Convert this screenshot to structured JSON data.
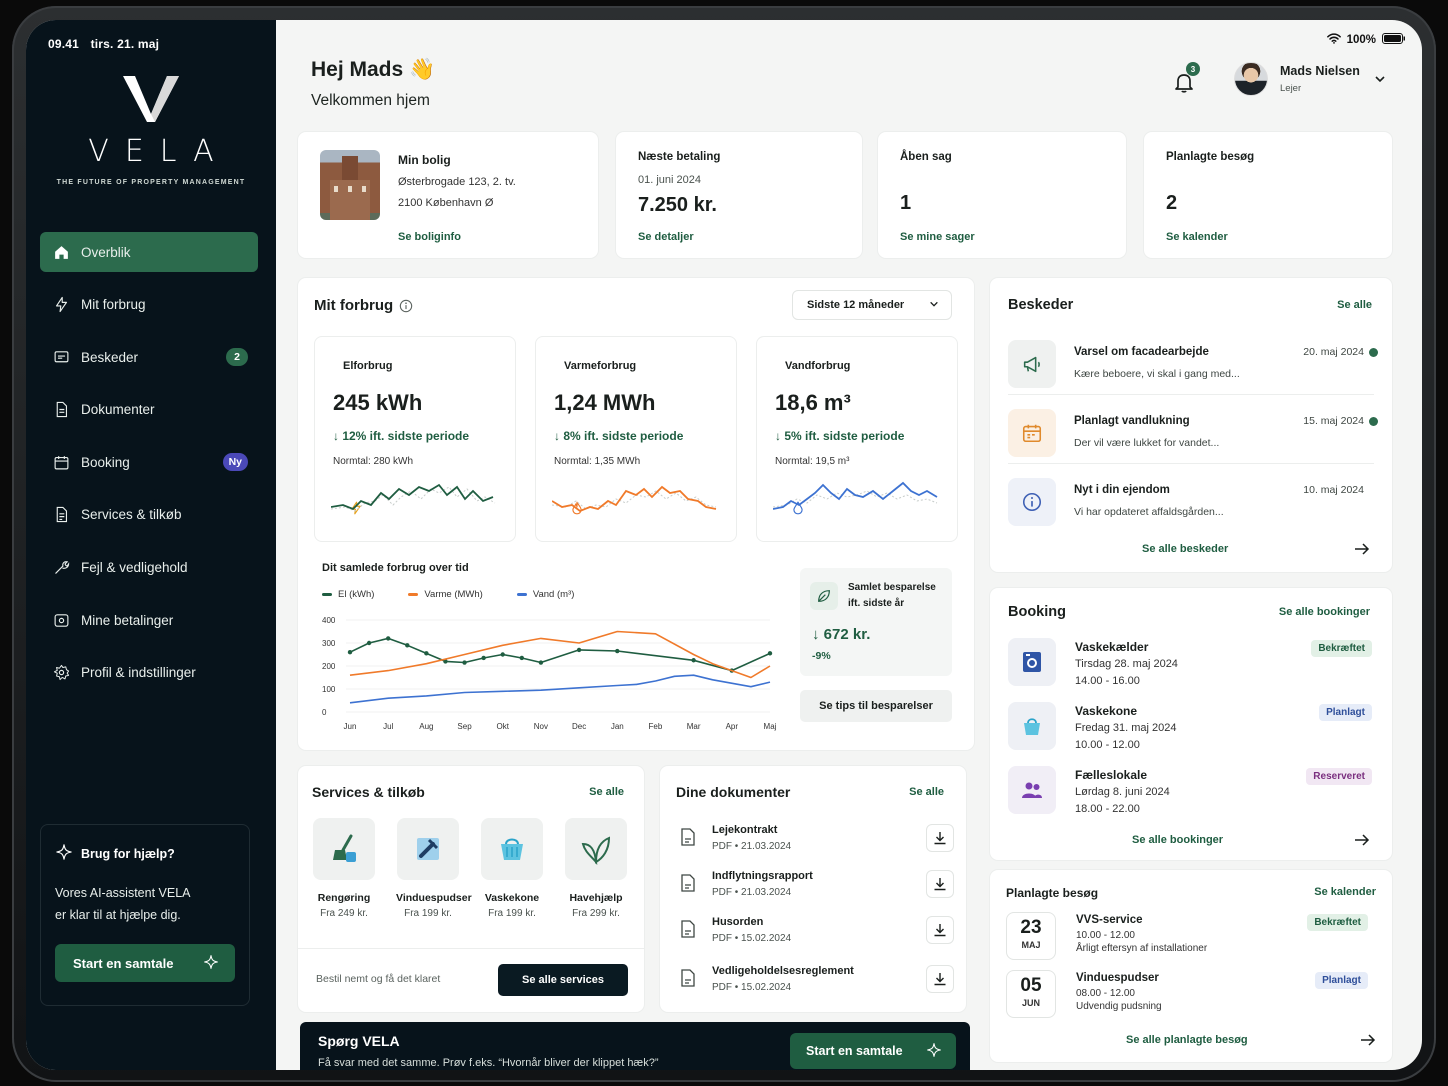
{
  "status": {
    "time": "09.41",
    "date": "tirs. 21. maj",
    "battery": "100%"
  },
  "brand": {
    "name": "VELA",
    "tagline": "THE FUTURE OF PROPERTY MANAGEMENT"
  },
  "sidebar": {
    "items": [
      {
        "label": "Overblik",
        "icon": "home-icon",
        "active": true
      },
      {
        "label": "Mit forbrug",
        "icon": "bolt-icon"
      },
      {
        "label": "Beskeder",
        "icon": "message-icon",
        "badge": "2"
      },
      {
        "label": "Dokumenter",
        "icon": "document-icon"
      },
      {
        "label": "Booking",
        "icon": "calendar-icon",
        "badge": "Ny"
      },
      {
        "label": "Services & tilkøb",
        "icon": "services-icon"
      },
      {
        "label": "Fejl & vedligehold",
        "icon": "wrench-icon"
      },
      {
        "label": "Mine betalinger",
        "icon": "payment-icon"
      },
      {
        "label": "Profil & indstillinger",
        "icon": "gear-icon"
      }
    ],
    "help": {
      "title": "Brug for hjælp?",
      "text_line1": "Vores AI-assistent VELA",
      "text_line2": "er klar til at hjælpe dig.",
      "button": "Start en samtale"
    }
  },
  "header": {
    "greeting": "Hej Mads 👋",
    "subtitle": "Velkommen hjem",
    "notifications": "3",
    "user_name": "Mads Nielsen",
    "user_role": "Lejer"
  },
  "summary": {
    "home": {
      "title": "Min bolig",
      "line1": "Østerbrogade 123, 2. tv.",
      "line2": "2100 København Ø",
      "link": "Se boliginfo"
    },
    "payment": {
      "title": "Næste betaling",
      "date": "01. juni 2024",
      "amount": "7.250 kr.",
      "link": "Se detaljer"
    },
    "case": {
      "title": "Åben sag",
      "count": "1",
      "link": "Se mine sager"
    },
    "visits": {
      "title": "Planlagte besøg",
      "count": "2",
      "link": "Se kalender"
    }
  },
  "consumption": {
    "title": "Mit forbrug",
    "period": "Sidste 12 måneder",
    "el": {
      "title": "Elforbrug",
      "value": "245 kWh",
      "delta": "↓ 12% ift. sidste periode",
      "normal": "Normtal: 280 kWh",
      "color": "#1f5d41"
    },
    "heat": {
      "title": "Varmeforbrug",
      "value": "1,24 MWh",
      "delta": "↓ 8% ift. sidste periode",
      "normal": "Normtal: 1,35 MWh",
      "color": "#f07a2a"
    },
    "water": {
      "title": "Vandforbrug",
      "value": "18,6 m³",
      "delta": "↓ 5% ift. sidste periode",
      "normal": "Normtal: 19,5 m³",
      "color": "#3d72d1"
    },
    "overtime_title": "Dit samlede forbrug over tid",
    "savings": {
      "title_line1": "Samlet besparelse",
      "title_line2": "ift. sidste år",
      "amount": "↓ 672 kr.",
      "pct": "-9%",
      "button": "Se tips til besparelser"
    }
  },
  "chart_data": {
    "type": "line",
    "title": "Dit samlede forbrug over tid",
    "categories": [
      "Jun",
      "Jul",
      "Aug",
      "Sep",
      "Okt",
      "Nov",
      "Dec",
      "Jan",
      "Feb",
      "Mar",
      "Apr",
      "Maj"
    ],
    "ylim": [
      0,
      400
    ],
    "yticks": [
      0,
      100,
      200,
      300,
      400
    ],
    "series": [
      {
        "name": "El (kWh)",
        "color": "#1f5d41",
        "values": [
          260,
          300,
          320,
          290,
          255,
          220,
          215,
          235,
          250,
          235,
          215,
          270,
          265,
          225,
          180,
          255
        ],
        "x": [
          0,
          0.5,
          1,
          1.5,
          2,
          2.5,
          3,
          3.5,
          4,
          4.5,
          5,
          6,
          7,
          9,
          10,
          11
        ]
      },
      {
        "name": "Varme (MWh)",
        "color": "#f07a2a",
        "values": [
          160,
          180,
          210,
          250,
          290,
          320,
          300,
          350,
          340,
          250,
          210,
          150,
          200
        ],
        "x": [
          0,
          1,
          2,
          3,
          4,
          5,
          6,
          7,
          8,
          9,
          9.5,
          10.5,
          11
        ]
      },
      {
        "name": "Vand (m³)",
        "color": "#3d72d1",
        "values": [
          40,
          60,
          70,
          85,
          90,
          95,
          105,
          115,
          120,
          135,
          155,
          160,
          140,
          110,
          130
        ],
        "x": [
          0,
          1,
          2,
          3,
          4,
          5,
          6,
          7,
          7.5,
          8,
          8.5,
          9,
          9.5,
          10.5,
          11
        ]
      }
    ]
  },
  "services": {
    "title": "Services & tilkøb",
    "link": "Se alle",
    "items": [
      {
        "name": "Rengøring",
        "price": "Fra 249 kr.",
        "icon": "broom-icon"
      },
      {
        "name": "Vinduespudser",
        "price": "Fra 199 kr.",
        "icon": "squeegee-icon"
      },
      {
        "name": "Vaskekone",
        "price": "Fra 199 kr.",
        "icon": "basket-icon"
      },
      {
        "name": "Havehjælp",
        "price": "Fra 299 kr.",
        "icon": "leaf-icon"
      }
    ],
    "footer_text": "Bestil nemt og få det klaret",
    "footer_button": "Se alle services"
  },
  "documents": {
    "title": "Dine dokumenter",
    "link": "Se alle",
    "items": [
      {
        "name": "Lejekontrakt",
        "meta": "PDF • 21.03.2024"
      },
      {
        "name": "Indflytningsrapport",
        "meta": "PDF • 21.03.2024"
      },
      {
        "name": "Husorden",
        "meta": "PDF • 15.02.2024"
      },
      {
        "name": "Vedligeholdelsesreglement",
        "meta": "PDF • 15.02.2024"
      }
    ]
  },
  "messages": {
    "title": "Beskeder",
    "link": "Se alle",
    "items": [
      {
        "title": "Varsel om facadearbejde",
        "snippet": "Kære beboere, vi skal i gang med...",
        "date": "20. maj 2024",
        "unread": true,
        "icon": "megaphone-icon"
      },
      {
        "title": "Planlagt vandlukning",
        "snippet": "Der vil være lukket for vandet...",
        "date": "15. maj 2024",
        "unread": true,
        "icon": "calendar-icon"
      },
      {
        "title": "Nyt i din ejendom",
        "snippet": "Vi har opdateret affaldsgården...",
        "date": "10. maj 2024",
        "unread": false,
        "icon": "info-icon"
      }
    ],
    "footer_link": "Se alle beskeder"
  },
  "booking": {
    "title": "Booking",
    "link": "Se alle bookinger",
    "items": [
      {
        "title": "Vaskekælder",
        "line1": "Tirsdag 28. maj 2024",
        "line2": "14.00 - 16.00",
        "status": "Bekræftet",
        "icon": "washer-icon"
      },
      {
        "title": "Vaskekone",
        "line1": "Fredag 31. maj 2024",
        "line2": "10.00 - 12.00",
        "status": "Planlagt",
        "icon": "basket-icon"
      },
      {
        "title": "Fælleslokale",
        "line1": "Lørdag 8. juni 2024",
        "line2": "18.00 - 22.00",
        "status": "Reserveret",
        "icon": "people-icon"
      }
    ],
    "footer_link": "Se alle bookinger"
  },
  "visits": {
    "title": "Planlagte besøg",
    "link": "Se kalender",
    "items": [
      {
        "day": "23",
        "month": "MAJ",
        "title": "VVS-service",
        "time": "10.00 - 12.00",
        "desc": "Årligt eftersyn af installationer",
        "status": "Bekræftet"
      },
      {
        "day": "05",
        "month": "JUN",
        "title": "Vinduespudser",
        "time": "08.00 - 12.00",
        "desc": "Udvendig pudsning",
        "status": "Planlagt"
      }
    ],
    "footer_link": "Se alle planlagte besøg"
  },
  "ask": {
    "title": "Spørg VELA",
    "text": "Få svar med det samme. Prøv f.eks. “Hvornår bliver der klippet hæk?”",
    "button": "Start en samtale"
  }
}
